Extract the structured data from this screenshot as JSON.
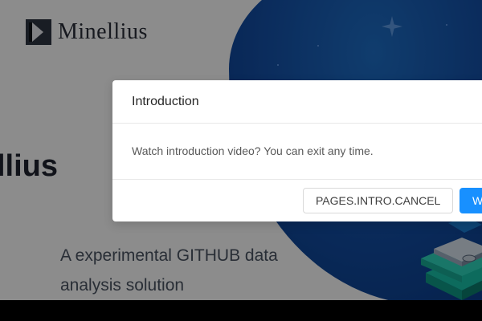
{
  "brand": {
    "name": "Minellius",
    "hero_title": "Minellius",
    "tagline": "A experimental GITHUB data analysis solution"
  },
  "modal": {
    "title": "Introduction",
    "message": "Watch introduction video? You can exit any time.",
    "cancel_label": "PAGES.INTRO.CANCEL",
    "confirm_label": "Watch"
  },
  "colors": {
    "primary": "#1890ff",
    "hero_blue": "#1450a8"
  }
}
